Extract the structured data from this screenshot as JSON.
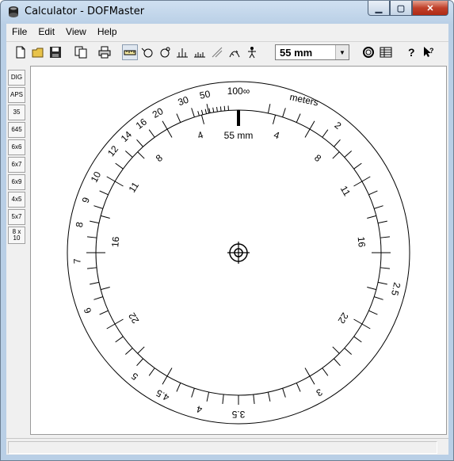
{
  "window": {
    "title": "Calculator - DOFMaster"
  },
  "menubar": {
    "items": [
      "File",
      "Edit",
      "View",
      "Help"
    ]
  },
  "toolbar": {
    "lens_value": "55 mm"
  },
  "sidebar": {
    "formats": [
      "DIG",
      "APS",
      "35",
      "645",
      "6x6",
      "6x7",
      "6x9",
      "4x5",
      "5x7",
      "8 x\n10"
    ]
  },
  "dial": {
    "unit_label": "meters",
    "focal_label": "55 mm",
    "outer_labels": [
      {
        "text": "100∞",
        "deg": 0
      },
      {
        "text": "50",
        "deg": -12
      },
      {
        "text": "30",
        "deg": -20
      },
      {
        "text": "20",
        "deg": -30
      },
      {
        "text": "16",
        "deg": -37
      },
      {
        "text": "14",
        "deg": -44
      },
      {
        "text": "12",
        "deg": -51
      },
      {
        "text": "10",
        "deg": -62
      },
      {
        "text": "9",
        "deg": -71
      },
      {
        "text": "8",
        "deg": -80
      },
      {
        "text": "7",
        "deg": -93
      },
      {
        "text": "6",
        "deg": -111
      },
      {
        "text": "5",
        "deg": -140
      },
      {
        "text": "4.5",
        "deg": -152
      },
      {
        "text": "4",
        "deg": -166
      },
      {
        "text": "3.5",
        "deg": 180
      },
      {
        "text": "3",
        "deg": 150
      },
      {
        "text": "2.5",
        "deg": 103
      },
      {
        "text": "2",
        "deg": 38
      }
    ],
    "inner_labels": [
      {
        "text": "4",
        "deg": -18
      },
      {
        "text": "4",
        "deg": 18
      },
      {
        "text": "8",
        "deg": -40
      },
      {
        "text": "8",
        "deg": 40
      },
      {
        "text": "11",
        "deg": -58
      },
      {
        "text": "11",
        "deg": 60
      },
      {
        "text": "16",
        "deg": -85
      },
      {
        "text": "16",
        "deg": 85
      },
      {
        "text": "22",
        "deg": -122
      },
      {
        "text": "22",
        "deg": 122
      }
    ]
  }
}
